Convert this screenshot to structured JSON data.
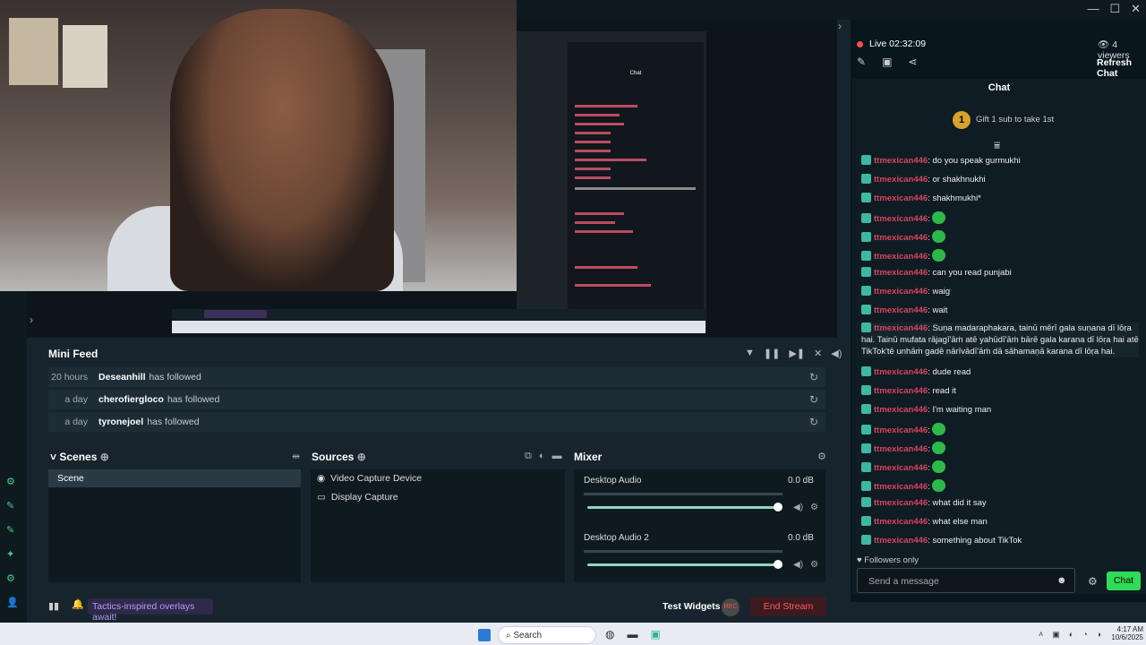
{
  "window": {
    "minimize": "—",
    "maximize": "☐",
    "close": "✕"
  },
  "preview": {
    "mini_overlay_text": "Tactics-inspired overlays await!",
    "mini_chat_title": "Chat"
  },
  "mini_feed": {
    "title": "Mini Feed",
    "rows": [
      {
        "time": "20 hours",
        "name": "Deseanhill",
        "action": "has followed"
      },
      {
        "time": "a day",
        "name": "cherofiergloco",
        "action": "has followed"
      },
      {
        "time": "a day",
        "name": "tyronejoel",
        "action": "has followed"
      }
    ]
  },
  "scenes": {
    "title": "Scenes",
    "items": [
      "Scene"
    ]
  },
  "sources": {
    "title": "Sources",
    "items": [
      "Video Capture Device",
      "Display Capture"
    ]
  },
  "mixer": {
    "title": "Mixer",
    "channels": [
      {
        "label": "Desktop Audio",
        "db": "0.0 dB",
        "level": 1.0
      },
      {
        "label": "Desktop Audio 2",
        "db": "0.0 dB",
        "level": 1.0
      }
    ]
  },
  "footer": {
    "promo": "Tactics-inspired overlays await!",
    "test_widgets": "Test Widgets",
    "rec": "REC",
    "end_stream": "End Stream"
  },
  "chat": {
    "live_label": "Live 02:32:09",
    "viewers": "4 viewers",
    "refresh": "Refresh Chat",
    "title": "Chat",
    "gift_rank": "1",
    "gift_text": "Gift 1 sub to take 1st",
    "followers_only": "Followers only",
    "input_placeholder": "Send a message",
    "send_label": "Chat",
    "messages": [
      {
        "user": "ttmexican446",
        "text": ": do you speak gurmukhi"
      },
      {
        "user": "ttmexican446",
        "text": ": or shakhnukhi"
      },
      {
        "user": "ttmexican446",
        "text": ": shakhmukhi*"
      },
      {
        "user": "ttmexican446",
        "text": ":"
      },
      {
        "user": "ttmexican446",
        "text": ":"
      },
      {
        "user": "ttmexican446",
        "text": ":"
      },
      {
        "user": "ttmexican446",
        "text": ": can you read punjabi"
      },
      {
        "user": "ttmexican446",
        "text": ": waig"
      },
      {
        "user": "ttmexican446",
        "text": ": wait"
      },
      {
        "user": "ttmexican446",
        "text": ": Suṇa madaraphakara, tainū mērī gala suṇana dī lōṛa hai. Tainū mufata rājagī'āṁ atē yahūdī'āṁ bārē gala karana dī lōṛa hai atē TikTok'tē unhāṁ gadē nārīvādī'āṁ dā sāhamaṇā karana dī lōṛa hai."
      },
      {
        "user": "ttmexican446",
        "text": ": dude read"
      },
      {
        "user": "ttmexican446",
        "text": ": read it"
      },
      {
        "user": "ttmexican446",
        "text": ": I'm waiting man"
      },
      {
        "user": "ttmexican446",
        "text": ":"
      },
      {
        "user": "ttmexican446",
        "text": ":"
      },
      {
        "user": "ttmexican446",
        "text": ":"
      },
      {
        "user": "ttmexican446",
        "text": ":"
      },
      {
        "user": "ttmexican446",
        "text": ": what did it say"
      },
      {
        "user": "ttmexican446",
        "text": ": what else man"
      },
      {
        "user": "ttmexican446",
        "text": ": something about TikTok"
      }
    ]
  },
  "taskbar": {
    "search": "Search",
    "time": "4:17 AM",
    "date": "10/6/2025"
  }
}
